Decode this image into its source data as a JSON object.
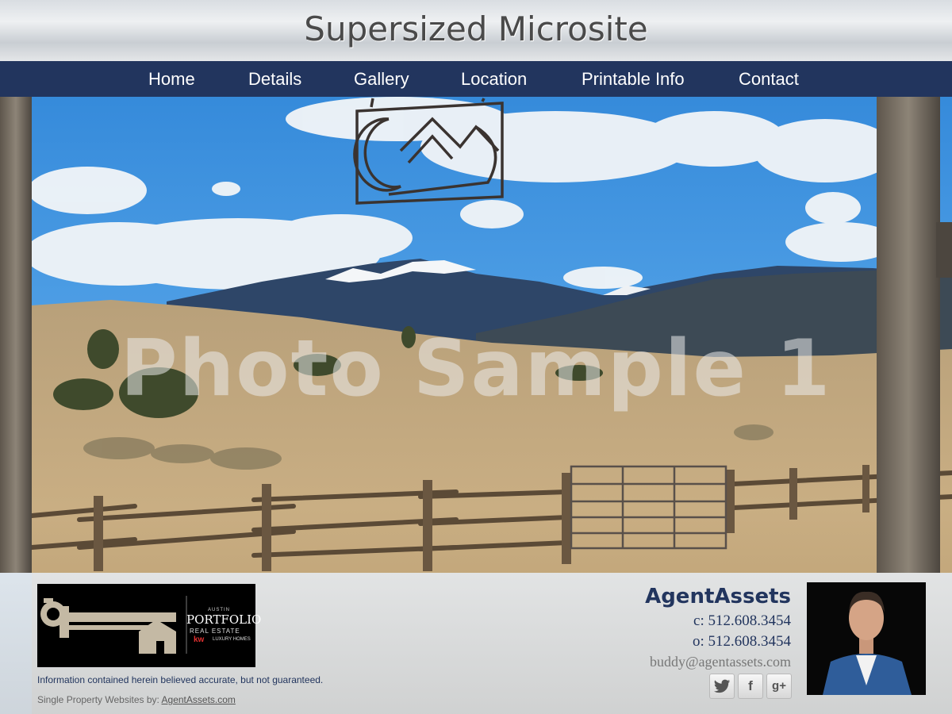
{
  "header": {
    "title": "Supersized Microsite"
  },
  "nav": {
    "items": [
      {
        "label": "Home"
      },
      {
        "label": "Details"
      },
      {
        "label": "Gallery"
      },
      {
        "label": "Location"
      },
      {
        "label": "Printable Info"
      },
      {
        "label": "Contact"
      }
    ]
  },
  "hero": {
    "watermark": "Photo Sample 1"
  },
  "footer": {
    "logo": {
      "small_line": "AUSTIN",
      "name": "PORTFOLIO",
      "sub": "REAL ESTATE",
      "kw": "kw",
      "lux": "LUXURY HOMES"
    },
    "disclaimer": "Information contained herein believed accurate, but not guaranteed.",
    "credit_prefix": "Single Property Websites by: ",
    "credit_link": "AgentAssets.com",
    "agent": {
      "name": "AgentAssets",
      "cell": "c: 512.608.3454",
      "office": "o: 512.608.3454",
      "email": "buddy@agentassets.com"
    },
    "social": [
      {
        "icon": "twitter-icon"
      },
      {
        "icon": "facebook-icon",
        "glyph": "f"
      },
      {
        "icon": "google-plus-icon",
        "glyph": "g+"
      }
    ]
  },
  "colors": {
    "nav_bg": "#22355e",
    "accent_text": "#22355e"
  }
}
